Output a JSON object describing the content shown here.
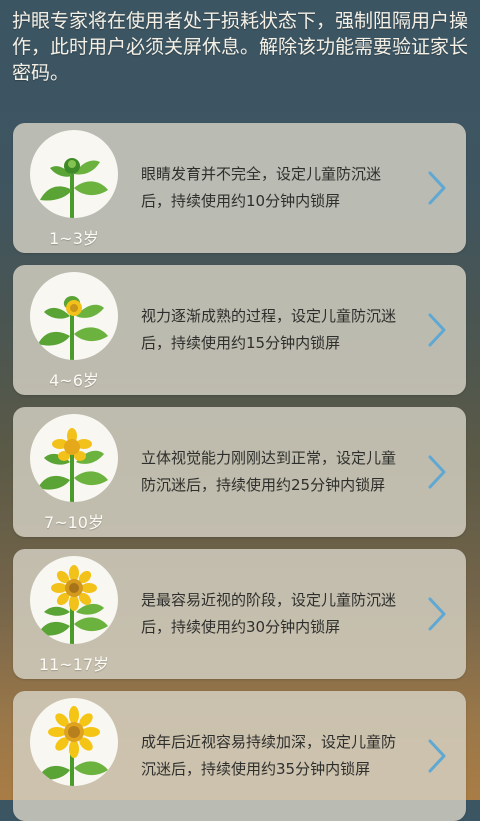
{
  "intro": "护眼专家将在使用者处于损耗状态下，强制阻隔用户操作，此时用户必须关屏休息。解除该功能需要验证家长密码。",
  "cards": [
    {
      "age": "1~3岁",
      "desc": "眼睛发育并不完全，设定儿童防沉迷后，持续使用约10分钟内锁屏",
      "icon": "sunflower-sprout-icon"
    },
    {
      "age": "4~6岁",
      "desc": "视力逐渐成熟的过程，设定儿童防沉迷后，持续使用约15分钟内锁屏",
      "icon": "sunflower-bud-icon"
    },
    {
      "age": "7~10岁",
      "desc": "立体视觉能力刚刚达到正常，设定儿童防沉迷后，持续使用约25分钟内锁屏",
      "icon": "sunflower-opening-icon"
    },
    {
      "age": "11~17岁",
      "desc": "是最容易近视的阶段，设定儿童防沉迷后，持续使用约30分钟内锁屏",
      "icon": "sunflower-blooming-icon"
    },
    {
      "age": "",
      "desc": "成年后近视容易持续加深，设定儿童防沉迷后，持续使用约35分钟内锁屏",
      "icon": "sunflower-full-bloom-icon"
    }
  ],
  "colors": {
    "arrow": "#5fa8d3",
    "card": "#d6d2c4",
    "leaf": "#5aa335",
    "petal": "#f2c21a"
  }
}
